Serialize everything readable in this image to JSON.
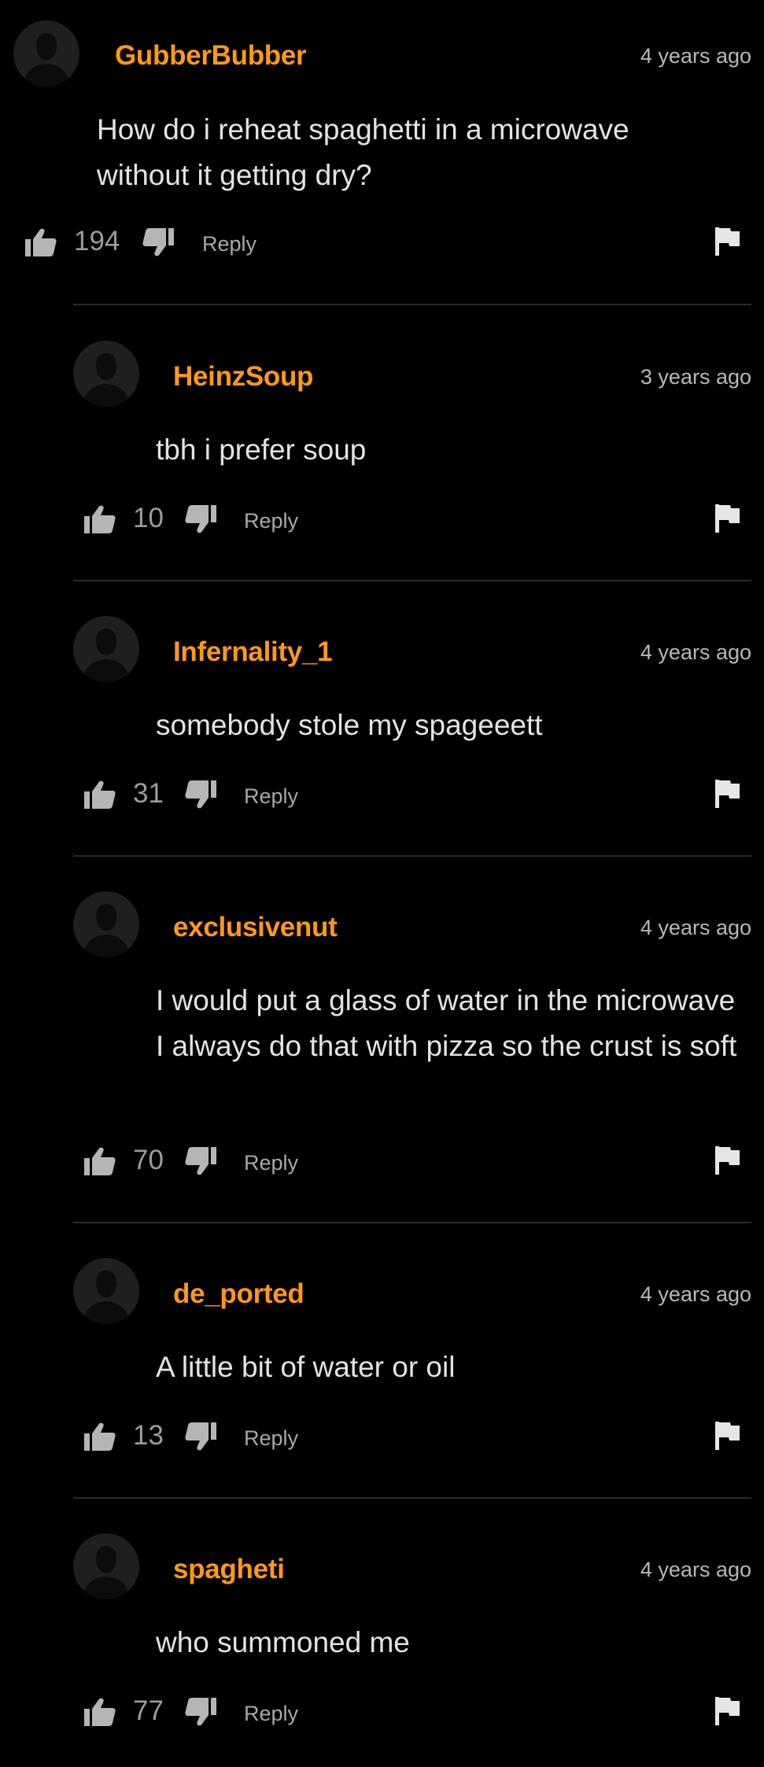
{
  "colors": {
    "background": "#000000",
    "username": "#ff9915",
    "body_text": "#e3e3e3",
    "muted": "#9c9c9c",
    "divider": "#2a2a2a"
  },
  "comments": [
    {
      "username": "GubberBubber",
      "time": "4 years ago",
      "text": "How do i reheat spaghetti in a microwave without it getting dry?",
      "likes": "194",
      "reply_label": "Reply"
    },
    {
      "username": "HeinzSoup",
      "time": "3 years ago",
      "text": "tbh i prefer soup",
      "likes": "10",
      "reply_label": "Reply"
    },
    {
      "username": "Infernality_1",
      "time": "4 years ago",
      "text": "somebody stole my spageeett",
      "likes": "31",
      "reply_label": "Reply"
    },
    {
      "username": "exclusivenut",
      "time": "4 years ago",
      "text": "I would put a glass of water in the microwave I always do that with pizza so the crust is soft",
      "likes": "70",
      "reply_label": "Reply"
    },
    {
      "username": "de_ported",
      "time": "4 years ago",
      "text": "A little bit of water or oil",
      "likes": "13",
      "reply_label": "Reply"
    },
    {
      "username": "spagheti",
      "time": "4 years ago",
      "text": "who summoned me",
      "likes": "77",
      "reply_label": "Reply"
    }
  ]
}
